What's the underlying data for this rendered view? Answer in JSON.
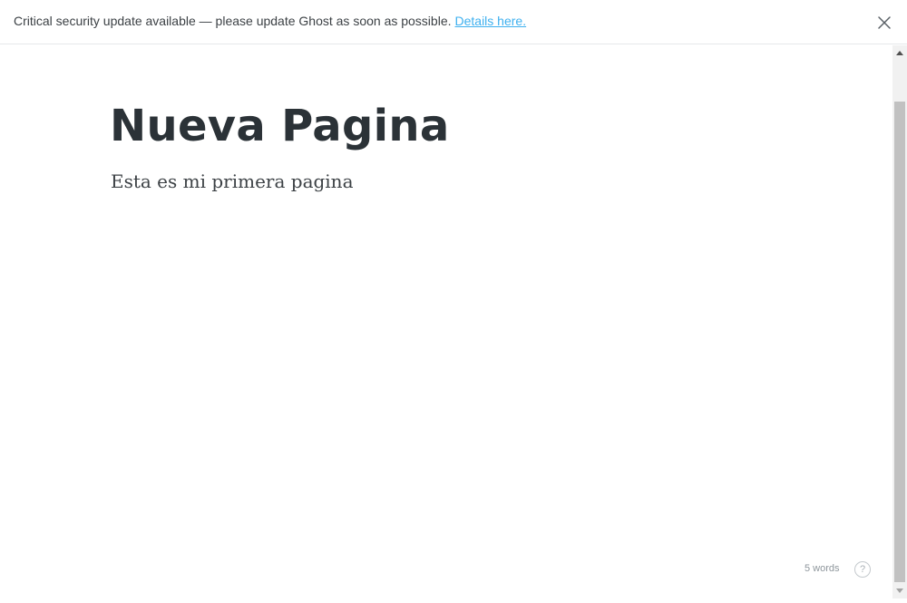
{
  "banner": {
    "message": "Critical security update available — please update Ghost as soon as possible.",
    "link_text": "Details here.",
    "link_color": "#3eb0ef"
  },
  "editor": {
    "title": "Nueva Pagina",
    "body": "Esta es mi primera pagina",
    "word_count": "5 words",
    "help_label": "?"
  },
  "icons": {
    "close": "close-icon",
    "help": "help-icon",
    "scroll_up": "arrow-up-icon",
    "scroll_down": "arrow-down-icon"
  }
}
